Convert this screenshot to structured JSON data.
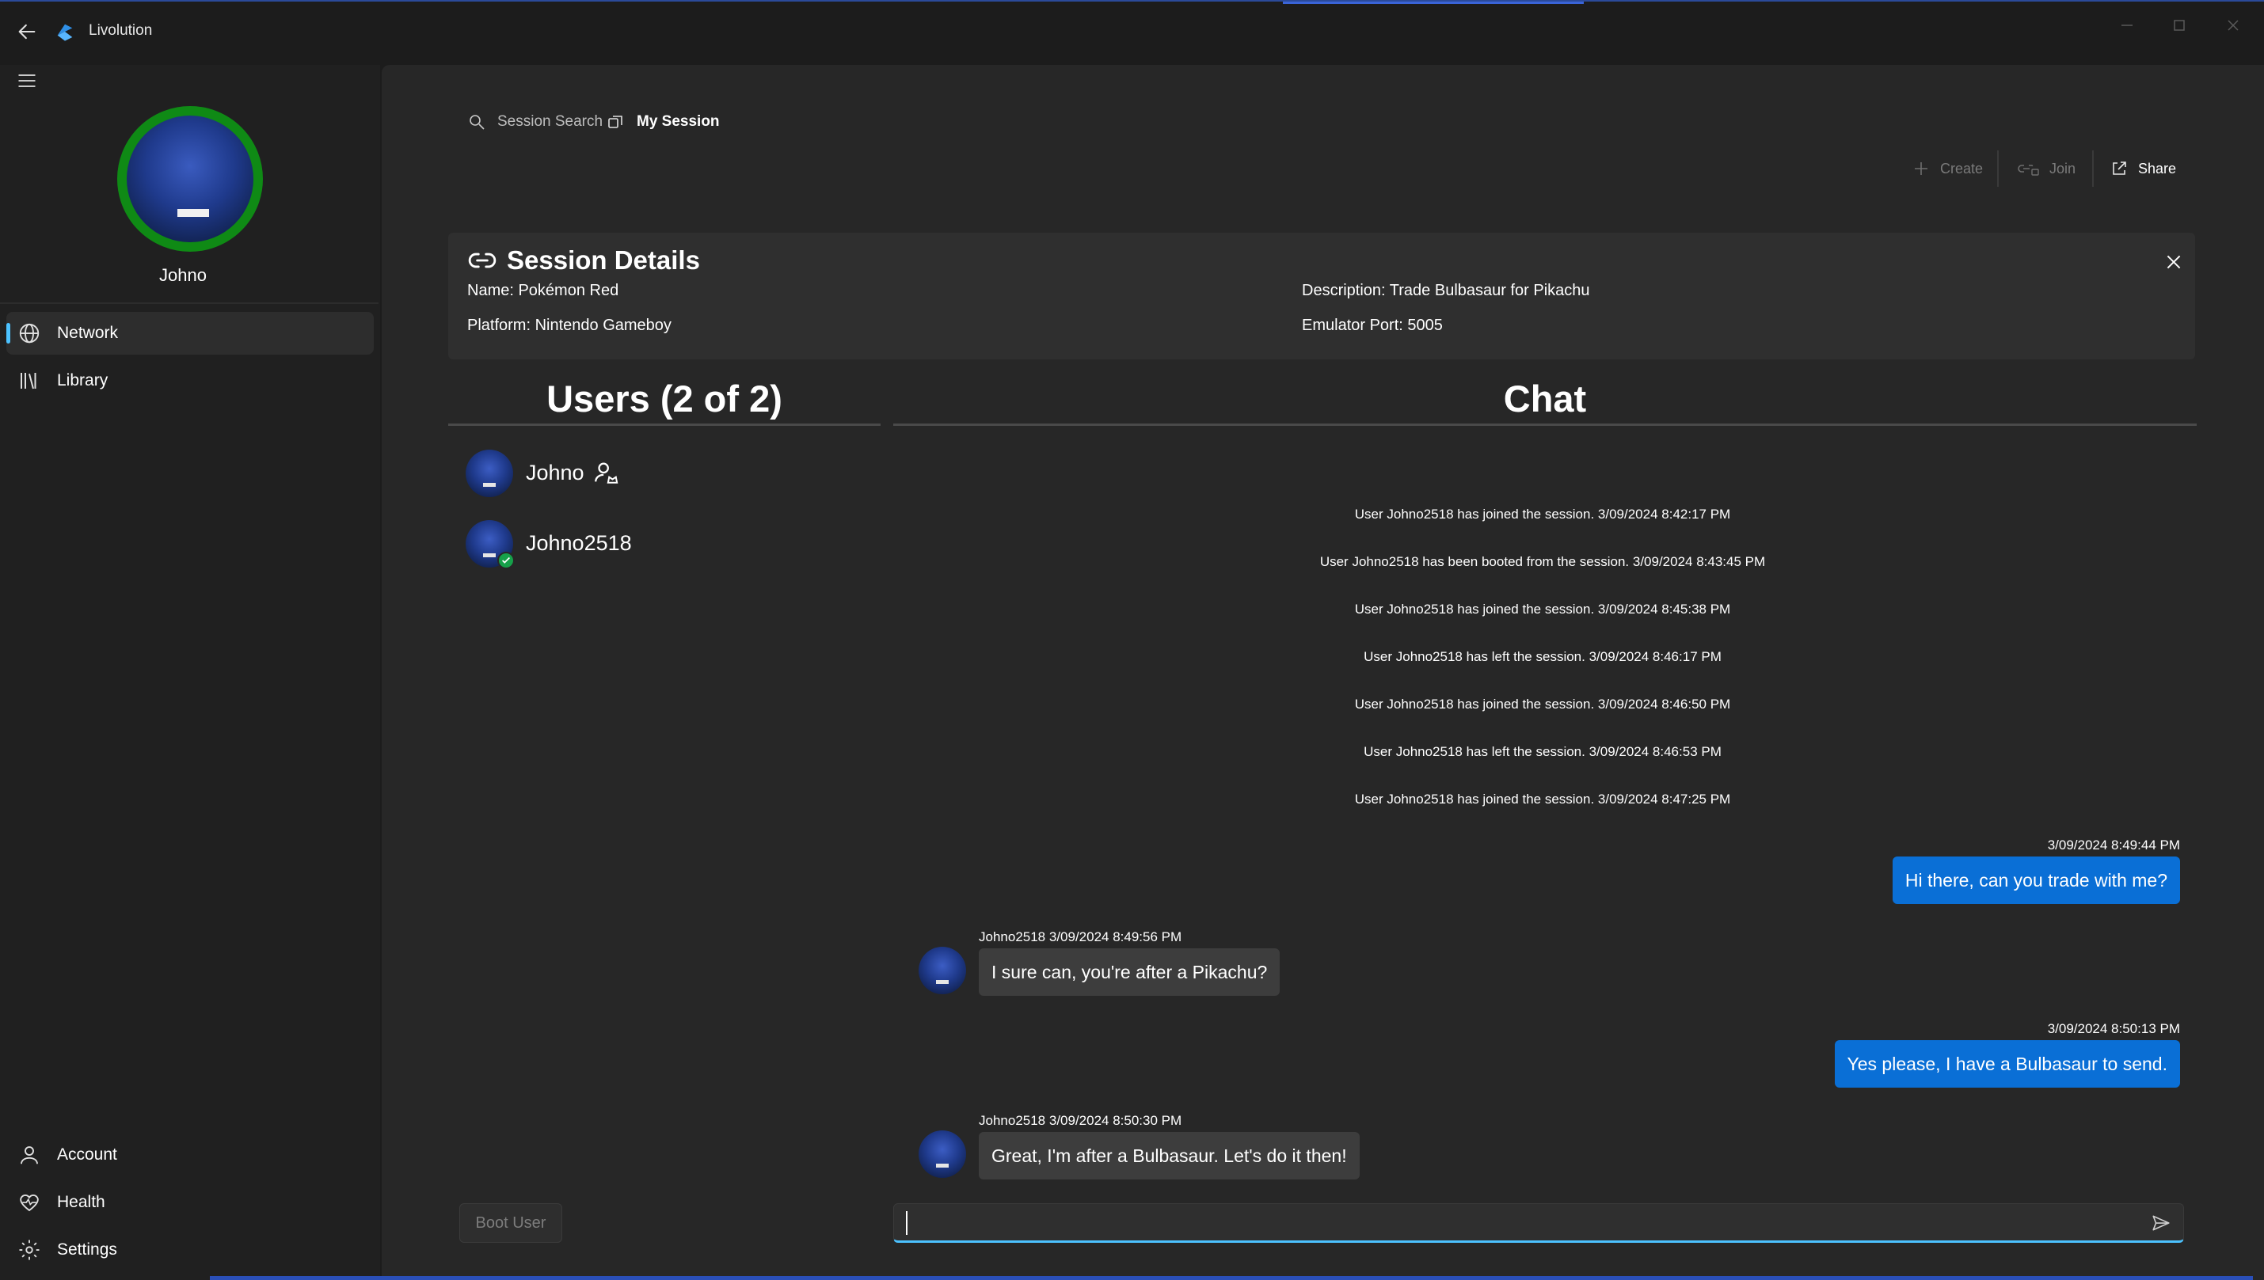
{
  "app": {
    "title": "Livolution"
  },
  "sidebar": {
    "username": "Johno",
    "nav": [
      {
        "label": "Network",
        "icon": "globe-icon",
        "selected": true
      },
      {
        "label": "Library",
        "icon": "library-icon",
        "selected": false
      }
    ],
    "footer": [
      {
        "label": "Account",
        "icon": "person-icon"
      },
      {
        "label": "Health",
        "icon": "heart-pulse-icon"
      },
      {
        "label": "Settings",
        "icon": "gear-icon"
      }
    ]
  },
  "tabs": [
    {
      "label": "Session Search",
      "icon": "search-icon",
      "active": false
    },
    {
      "label": "My Session",
      "icon": "session-icon",
      "active": true
    }
  ],
  "toolbar": {
    "create": "Create",
    "join": "Join",
    "share": "Share"
  },
  "session": {
    "title": "Session Details",
    "name": "Name: Pokémon Red",
    "platform": "Platform: Nintendo Gameboy",
    "description": "Description: Trade Bulbasaur for Pikachu",
    "port": "Emulator Port: 5005"
  },
  "users": {
    "header": "Users (2 of 2)",
    "list": [
      {
        "name": "Johno",
        "host": true,
        "connected": false
      },
      {
        "name": "Johno2518",
        "host": false,
        "connected": true
      }
    ]
  },
  "chat": {
    "header": "Chat",
    "system_messages": [
      "User Johno2518 has joined the session.   3/09/2024 8:42:17 PM",
      "User Johno2518 has been booted from the session.   3/09/2024 8:43:45 PM",
      "User Johno2518 has joined the session.   3/09/2024 8:45:38 PM",
      "User Johno2518 has left the session.   3/09/2024 8:46:17 PM",
      "User Johno2518 has joined the session.   3/09/2024 8:46:50 PM",
      "User Johno2518 has left the session.   3/09/2024 8:46:53 PM",
      "User Johno2518 has joined the session.   3/09/2024 8:47:25 PM"
    ],
    "messages": [
      {
        "direction": "out",
        "meta": "3/09/2024 8:49:44 PM",
        "text": "Hi there, can you trade with me?"
      },
      {
        "direction": "in",
        "meta": "Johno2518   3/09/2024 8:49:56 PM",
        "text": "I sure can, you're after a Pikachu?"
      },
      {
        "direction": "out",
        "meta": "3/09/2024 8:50:13 PM",
        "text": "Yes please, I have a Bulbasaur to send."
      },
      {
        "direction": "in",
        "meta": "Johno2518   3/09/2024 8:50:30 PM",
        "text": "Great, I'm after a Bulbasaur. Let's do it then!"
      }
    ],
    "input_value": ""
  },
  "boot_button": "Boot User",
  "colors": {
    "accent": "#4cc2ff",
    "bubble_out": "#0a6fd6",
    "bubble_in": "#3d3d3d",
    "avatar_ring": "#0f8a15",
    "online_badge": "#16a14a"
  }
}
